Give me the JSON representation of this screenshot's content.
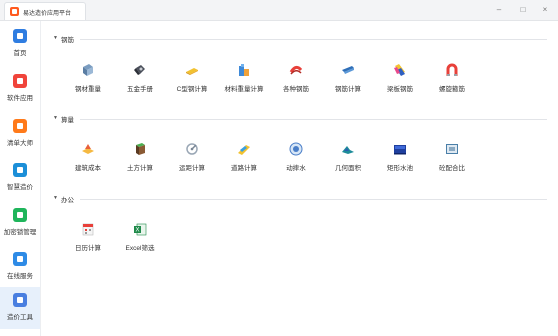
{
  "app": {
    "title": "易达造价应用平台"
  },
  "window": {
    "minimize": "–",
    "maximize": "□",
    "close": "×"
  },
  "sidebar": {
    "items": [
      {
        "label": "首页",
        "color": "#2f7de1"
      },
      {
        "label": "软件应用",
        "color": "#f0443b"
      },
      {
        "label": "清单大师",
        "color": "#ff7a1a"
      },
      {
        "label": "智慧造价",
        "color": "#1c8fd8"
      },
      {
        "label": "加密锁管理",
        "color": "#1fb55b"
      },
      {
        "label": "在线服务",
        "color": "#2e8be6"
      },
      {
        "label": "造价工具",
        "color": "#4a7fe0"
      }
    ]
  },
  "sections": [
    {
      "title": "钢筋",
      "tools": [
        {
          "label": "钢材重量",
          "icon": "steel-beam-icon"
        },
        {
          "label": "五金手册",
          "icon": "hardware-handbook-icon"
        },
        {
          "label": "C型钢计算",
          "icon": "c-steel-icon"
        },
        {
          "label": "材料重量计算",
          "icon": "material-weight-icon"
        },
        {
          "label": "各种钢筋",
          "icon": "rebar-types-icon"
        },
        {
          "label": "钢筋计算",
          "icon": "rebar-calc-icon"
        },
        {
          "label": "梁板钢筋",
          "icon": "beam-slab-icon"
        },
        {
          "label": "螺旋箍筋",
          "icon": "spiral-stirrup-icon"
        }
      ]
    },
    {
      "title": "算量",
      "tools": [
        {
          "label": "建筑成本",
          "icon": "building-cost-icon"
        },
        {
          "label": "土方计算",
          "icon": "earthwork-icon"
        },
        {
          "label": "运距计算",
          "icon": "haul-distance-icon"
        },
        {
          "label": "道路计算",
          "icon": "road-calc-icon"
        },
        {
          "label": "动摔水",
          "icon": "drainage-icon"
        },
        {
          "label": "几何面积",
          "icon": "geometry-area-icon"
        },
        {
          "label": "矩形水池",
          "icon": "rect-pool-icon"
        },
        {
          "label": "砼配合比",
          "icon": "concrete-mix-icon"
        }
      ]
    },
    {
      "title": "办公",
      "tools": [
        {
          "label": "日历计算",
          "icon": "calendar-icon"
        },
        {
          "label": "Excel筛选",
          "icon": "excel-filter-icon"
        }
      ]
    }
  ]
}
